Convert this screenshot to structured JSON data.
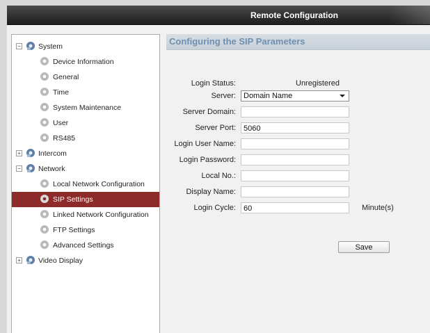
{
  "window": {
    "title": "Remote Configuration"
  },
  "sidebar": {
    "items": [
      {
        "label": "System",
        "type": "group",
        "expander": "−"
      },
      {
        "label": "Device Information",
        "type": "leaf"
      },
      {
        "label": "General",
        "type": "leaf"
      },
      {
        "label": "Time",
        "type": "leaf"
      },
      {
        "label": "System Maintenance",
        "type": "leaf"
      },
      {
        "label": "User",
        "type": "leaf"
      },
      {
        "label": "RS485",
        "type": "leaf"
      },
      {
        "label": "Intercom",
        "type": "group",
        "expander": "+"
      },
      {
        "label": "Network",
        "type": "group",
        "expander": "−"
      },
      {
        "label": "Local Network Configuration",
        "type": "leaf"
      },
      {
        "label": "SIP Settings",
        "type": "leaf",
        "selected": true
      },
      {
        "label": "Linked Network Configuration",
        "type": "leaf"
      },
      {
        "label": "FTP Settings",
        "type": "leaf"
      },
      {
        "label": "Advanced Settings",
        "type": "leaf"
      },
      {
        "label": "Video Display",
        "type": "group",
        "expander": "+"
      }
    ]
  },
  "main": {
    "title": "Configuring the SIP Parameters",
    "login_status_label": "Login Status:",
    "login_status_value": "Unregistered",
    "server_label": "Server:",
    "server_value": "Domain Name",
    "server_domain_label": "Server Domain:",
    "server_domain_value": "",
    "server_port_label": "Server Port:",
    "server_port_value": "5060",
    "login_user_name_label": "Login User Name:",
    "login_user_name_value": "",
    "login_password_label": "Login Password:",
    "login_password_value": "",
    "local_no_label": "Local No.:",
    "local_no_value": "",
    "display_name_label": "Display Name:",
    "display_name_value": "",
    "login_cycle_label": "Login Cycle:",
    "login_cycle_value": "60",
    "login_cycle_unit": "Minute(s)",
    "save_label": "Save"
  },
  "colors": {
    "selected": "#8d2a2a",
    "header_text": "#6f8fb0",
    "titlebar": "#2a2a2a"
  }
}
